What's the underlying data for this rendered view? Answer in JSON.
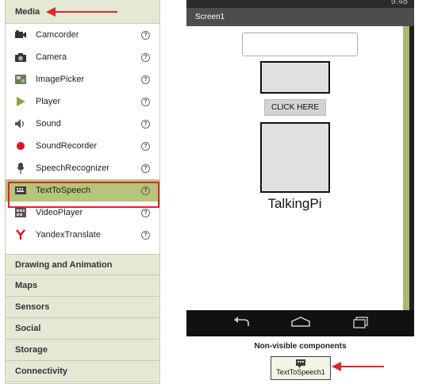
{
  "palette": {
    "media": {
      "title": "Media",
      "items": [
        {
          "label": "Camcorder",
          "icon": "camcorder-icon"
        },
        {
          "label": "Camera",
          "icon": "camera-icon"
        },
        {
          "label": "ImagePicker",
          "icon": "image-picker-icon"
        },
        {
          "label": "Player",
          "icon": "player-icon"
        },
        {
          "label": "Sound",
          "icon": "speaker-icon"
        },
        {
          "label": "SoundRecorder",
          "icon": "record-icon"
        },
        {
          "label": "SpeechRecognizer",
          "icon": "microphone-icon"
        },
        {
          "label": "TextToSpeech",
          "icon": "text-to-speech-icon",
          "selected": true
        },
        {
          "label": "VideoPlayer",
          "icon": "video-player-icon"
        },
        {
          "label": "YandexTranslate",
          "icon": "yandex-icon"
        }
      ],
      "help_glyph": "?"
    },
    "categories": [
      "Drawing and Animation",
      "Maps",
      "Sensors",
      "Social",
      "Storage",
      "Connectivity"
    ]
  },
  "viewer": {
    "status_time": "9:48",
    "screen_title": "Screen1",
    "button_label": "CLICK HERE",
    "label_text": "TalkingPi",
    "nonvisible_title": "Non-visible components",
    "nonvisible_component": "TextToSpeech1"
  },
  "colors": {
    "annotation_red": "#e0242a",
    "selected_row": "#b7c47a",
    "category_bg": "#e6e8d6",
    "scrollbar": "#a9b86d"
  }
}
